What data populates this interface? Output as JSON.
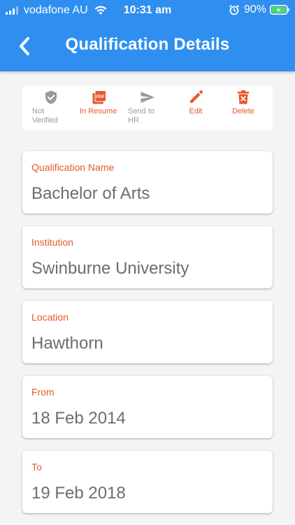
{
  "status": {
    "carrier": "vodafone AU",
    "time": "10:31 am",
    "battery": "90%"
  },
  "header": {
    "title": "Qualification Details"
  },
  "toolbar": {
    "not_verified": "Not Verified",
    "in_resume": "In Resume",
    "send_to_hr": "Send to HR",
    "edit": "Edit",
    "delete": "Delete"
  },
  "fields": [
    {
      "label": "Qualification Name",
      "value": "Bachelor of Arts"
    },
    {
      "label": "Institution",
      "value": "Swinburne University"
    },
    {
      "label": "Location",
      "value": "Hawthorn"
    },
    {
      "label": "From",
      "value": "18 Feb 2014"
    },
    {
      "label": "To",
      "value": "19 Feb 2018"
    }
  ],
  "colors": {
    "header": "#2f8ff0",
    "accent": "#e8572a",
    "disabled": "#9a9a9a",
    "value_text": "#6d6d6d"
  },
  "icons": [
    "signal-icon",
    "wifi-icon",
    "alarm-icon",
    "battery-icon",
    "back-arrow-icon",
    "shield-check-icon",
    "pdf-icon",
    "send-icon",
    "pencil-icon",
    "trash-icon"
  ]
}
